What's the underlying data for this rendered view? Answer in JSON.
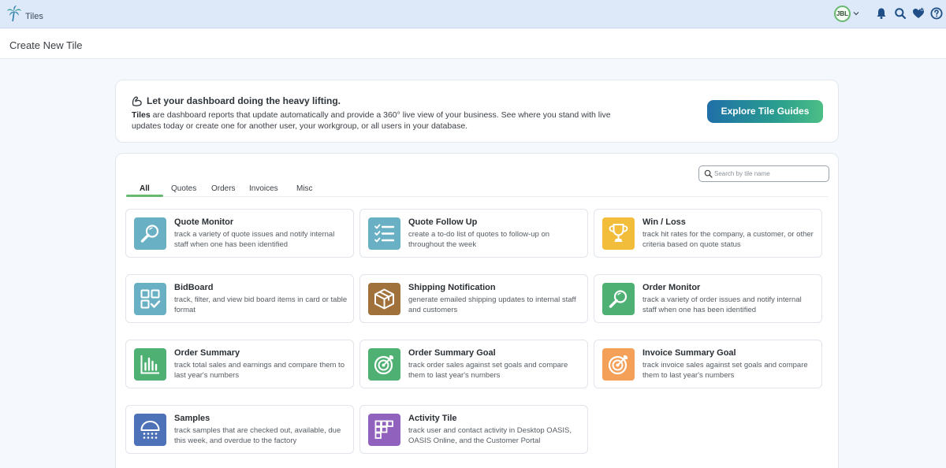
{
  "app": {
    "title": "Tiles",
    "logo_icon": "palm-tree-icon"
  },
  "header": {
    "avatar_initials": "JBL",
    "icons": [
      "bell-icon",
      "search-icon",
      "heart-plus-icon",
      "help-icon"
    ]
  },
  "page": {
    "title": "Create New Tile"
  },
  "intro": {
    "heading": "Let your dashboard doing the heavy lifting.",
    "body_bold": "Tiles",
    "body_rest": " are dashboard reports that update automatically and provide a 360° live view of your business. See where you stand with live updates today or create one for another user, your workgroup, or all users in your database.",
    "button_label": "Explore Tile Guides"
  },
  "search": {
    "placeholder": "Search by tile name"
  },
  "tabs": [
    {
      "label": "All",
      "active": true
    },
    {
      "label": "Quotes"
    },
    {
      "label": "Orders"
    },
    {
      "label": "Invoices"
    },
    {
      "label": "Misc"
    }
  ],
  "tiles": [
    {
      "title": "Quote Monitor",
      "desc": "track a variety of quote issues and notify internal staff when one has been identified",
      "color": "#6ab0c4",
      "icon": "magnifier-icon"
    },
    {
      "title": "Quote Follow Up",
      "desc": "create a to-do list of quotes to follow-up on throughout the week",
      "color": "#6ab0c4",
      "icon": "checklist-icon"
    },
    {
      "title": "Win / Loss",
      "desc": "track hit rates for the company, a customer, or other criteria based on quote status",
      "color": "#f2bd3a",
      "icon": "trophy-icon"
    },
    {
      "title": "BidBoard",
      "desc": "track, filter, and view bid board items in card or table format",
      "color": "#6ab0c4",
      "icon": "grid-check-icon"
    },
    {
      "title": "Shipping Notification",
      "desc": "generate emailed shipping updates to internal staff and customers",
      "color": "#a0713a",
      "icon": "package-icon"
    },
    {
      "title": "Order Monitor",
      "desc": "track a variety of order issues and notify internal staff when one has been identified",
      "color": "#4fb073",
      "icon": "magnifier-icon"
    },
    {
      "title": "Order Summary",
      "desc": "track total sales and earnings and compare them to last year's numbers",
      "color": "#4fb073",
      "icon": "bar-chart-icon"
    },
    {
      "title": "Order Summary Goal",
      "desc": "track order sales against set goals and compare them to last year's numbers",
      "color": "#4fb073",
      "icon": "target-icon"
    },
    {
      "title": "Invoice Summary Goal",
      "desc": "track invoice sales against set goals and compare them to last year's numbers",
      "color": "#f4a058",
      "icon": "target-icon"
    },
    {
      "title": "Samples",
      "desc": "track samples that are checked out, available, due this week, and overdue to the factory",
      "color": "#4e72b8",
      "icon": "shower-icon"
    },
    {
      "title": "Activity Tile",
      "desc": "track user and contact activity in Desktop OASIS, OASIS Online, and the Customer Portal",
      "color": "#9162bd",
      "icon": "activity-grid-icon"
    }
  ]
}
